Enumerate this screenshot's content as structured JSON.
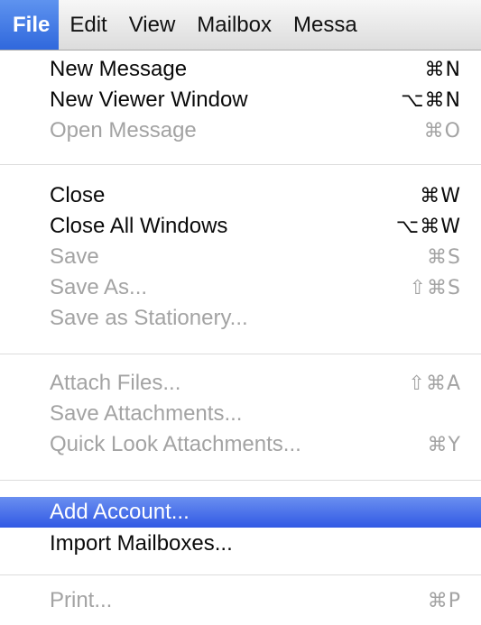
{
  "menubar": {
    "menus": [
      {
        "label": "File",
        "active": true
      },
      {
        "label": "Edit"
      },
      {
        "label": "View"
      },
      {
        "label": "Mailbox"
      },
      {
        "label": "Messa"
      }
    ]
  },
  "file_menu": {
    "items": [
      {
        "label": "New Message",
        "shortcut": "⌘N",
        "enabled": true
      },
      {
        "label": "New Viewer Window",
        "shortcut": "⌥⌘N",
        "enabled": true
      },
      {
        "label": "Open Message",
        "shortcut": "⌘O",
        "enabled": false
      },
      {
        "label": "Close",
        "shortcut": "⌘W",
        "enabled": true
      },
      {
        "label": "Close All Windows",
        "shortcut": "⌥⌘W",
        "enabled": true
      },
      {
        "label": "Save",
        "shortcut": "⌘S",
        "enabled": false
      },
      {
        "label": "Save As...",
        "shortcut": "⇧⌘S",
        "enabled": false
      },
      {
        "label": "Save as Stationery...",
        "shortcut": "",
        "enabled": false
      },
      {
        "label": "Attach Files...",
        "shortcut": "⇧⌘A",
        "enabled": false
      },
      {
        "label": "Save Attachments...",
        "shortcut": "",
        "enabled": false
      },
      {
        "label": "Quick Look Attachments...",
        "shortcut": "⌘Y",
        "enabled": false
      },
      {
        "label": "Add Account...",
        "shortcut": "",
        "enabled": true,
        "selected": true
      },
      {
        "label": "Import Mailboxes...",
        "shortcut": "",
        "enabled": true
      },
      {
        "label": "Print...",
        "shortcut": "⌘P",
        "enabled": false
      }
    ]
  },
  "colors": {
    "highlight": "#3a63e6",
    "disabled_text": "#a3a3a3",
    "enabled_text": "#0a0a0a"
  }
}
